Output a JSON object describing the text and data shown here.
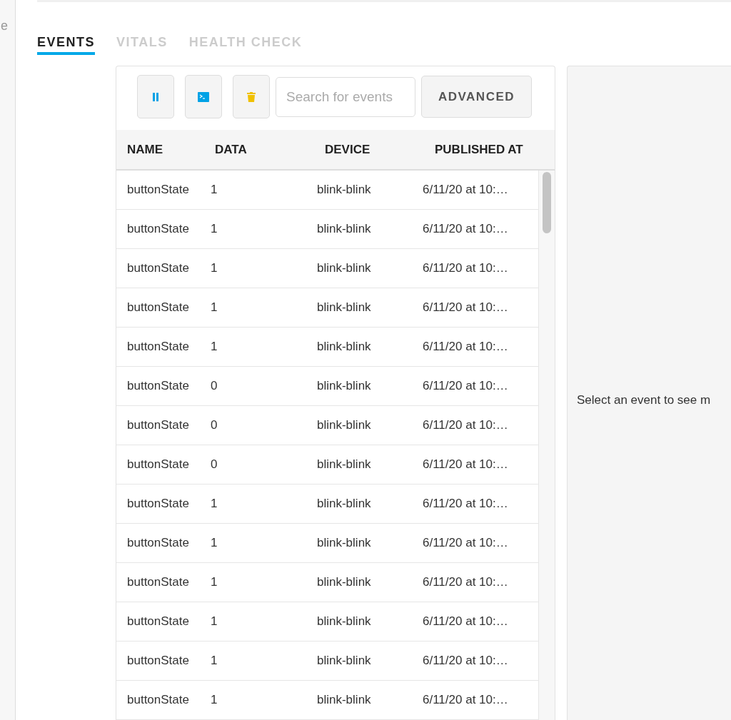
{
  "sidebar": {
    "text": "e"
  },
  "tabs": [
    {
      "label": "EVENTS",
      "selected": true
    },
    {
      "label": "VITALS",
      "selected": false
    },
    {
      "label": "HEALTH CHECK",
      "selected": false
    }
  ],
  "toolbar": {
    "search": {
      "placeholder": "Search for events"
    },
    "advanced_button": "ADVANCED"
  },
  "table": {
    "columns": [
      "NAME",
      "DATA",
      "DEVICE",
      "PUBLISHED AT"
    ],
    "rows": [
      {
        "name": "buttonState",
        "data": "1",
        "device": "blink-blink",
        "published_at": "6/11/20 at 10:…"
      },
      {
        "name": "buttonState",
        "data": "1",
        "device": "blink-blink",
        "published_at": "6/11/20 at 10:…"
      },
      {
        "name": "buttonState",
        "data": "1",
        "device": "blink-blink",
        "published_at": "6/11/20 at 10:…"
      },
      {
        "name": "buttonState",
        "data": "1",
        "device": "blink-blink",
        "published_at": "6/11/20 at 10:…"
      },
      {
        "name": "buttonState",
        "data": "1",
        "device": "blink-blink",
        "published_at": "6/11/20 at 10:…"
      },
      {
        "name": "buttonState",
        "data": "0",
        "device": "blink-blink",
        "published_at": "6/11/20 at 10:…"
      },
      {
        "name": "buttonState",
        "data": "0",
        "device": "blink-blink",
        "published_at": "6/11/20 at 10:…"
      },
      {
        "name": "buttonState",
        "data": "0",
        "device": "blink-blink",
        "published_at": "6/11/20 at 10:…"
      },
      {
        "name": "buttonState",
        "data": "1",
        "device": "blink-blink",
        "published_at": "6/11/20 at 10:…"
      },
      {
        "name": "buttonState",
        "data": "1",
        "device": "blink-blink",
        "published_at": "6/11/20 at 10:…"
      },
      {
        "name": "buttonState",
        "data": "1",
        "device": "blink-blink",
        "published_at": "6/11/20 at 10:…"
      },
      {
        "name": "buttonState",
        "data": "1",
        "device": "blink-blink",
        "published_at": "6/11/20 at 10:…"
      },
      {
        "name": "buttonState",
        "data": "1",
        "device": "blink-blink",
        "published_at": "6/11/20 at 10:…"
      },
      {
        "name": "buttonState",
        "data": "1",
        "device": "blink-blink",
        "published_at": "6/11/20 at 10:…"
      }
    ]
  },
  "details": {
    "message": "Select an event to see m"
  }
}
